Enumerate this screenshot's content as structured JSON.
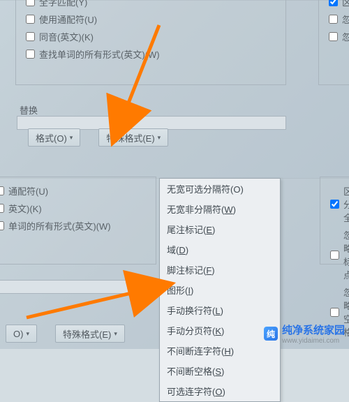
{
  "top": {
    "checkboxes": [
      {
        "label": "全字匹配(Y)",
        "checked": false,
        "name": "whole-words"
      },
      {
        "label": "使用通配符(U)",
        "checked": false,
        "name": "wildcards"
      },
      {
        "label": "同音(英文)(K)",
        "checked": false,
        "name": "sounds-like"
      },
      {
        "label": "查找单词的所有形式(英文)(W)",
        "checked": false,
        "name": "all-word-forms"
      }
    ],
    "right_checkboxes": [
      {
        "label": "区",
        "checked": true,
        "name": "right-cb-1"
      },
      {
        "label": "忽",
        "checked": false,
        "name": "right-cb-2"
      },
      {
        "label": "忽",
        "checked": false,
        "name": "right-cb-3"
      }
    ],
    "section_label": "替换",
    "format_button": "格式(O)",
    "special_button": "特殊格式(E)"
  },
  "bot": {
    "checkboxes": [
      {
        "label": "通配符(U)",
        "name": "wildcards"
      },
      {
        "label": "英文)(K)",
        "name": "sounds-like"
      },
      {
        "label": "单词的所有形式(英文)(W)",
        "name": "all-word-forms"
      }
    ],
    "right_checkboxes": [
      {
        "label": "区分全/",
        "checked": true,
        "name": "match-width"
      },
      {
        "label": "忽略标点",
        "checked": false,
        "name": "ignore-punct"
      },
      {
        "label": "忽略空格",
        "checked": false,
        "name": "ignore-space"
      }
    ],
    "format_button": "O)",
    "special_button": "特殊格式(E)",
    "menu_truncated_top": "无宽可选分隔符(O)",
    "menu": [
      "无宽非分隔符(W)",
      "尾注标记(E)",
      "域(D)",
      "脚注标记(F)",
      "图形(I)",
      "手动换行符(L)",
      "手动分页符(K)",
      "不间断连字符(H)",
      "不间断空格(S)",
      "可选连字符(O)"
    ]
  },
  "footer": {
    "brand": "纯净系统家园",
    "url": "www.yidaimei.com"
  }
}
